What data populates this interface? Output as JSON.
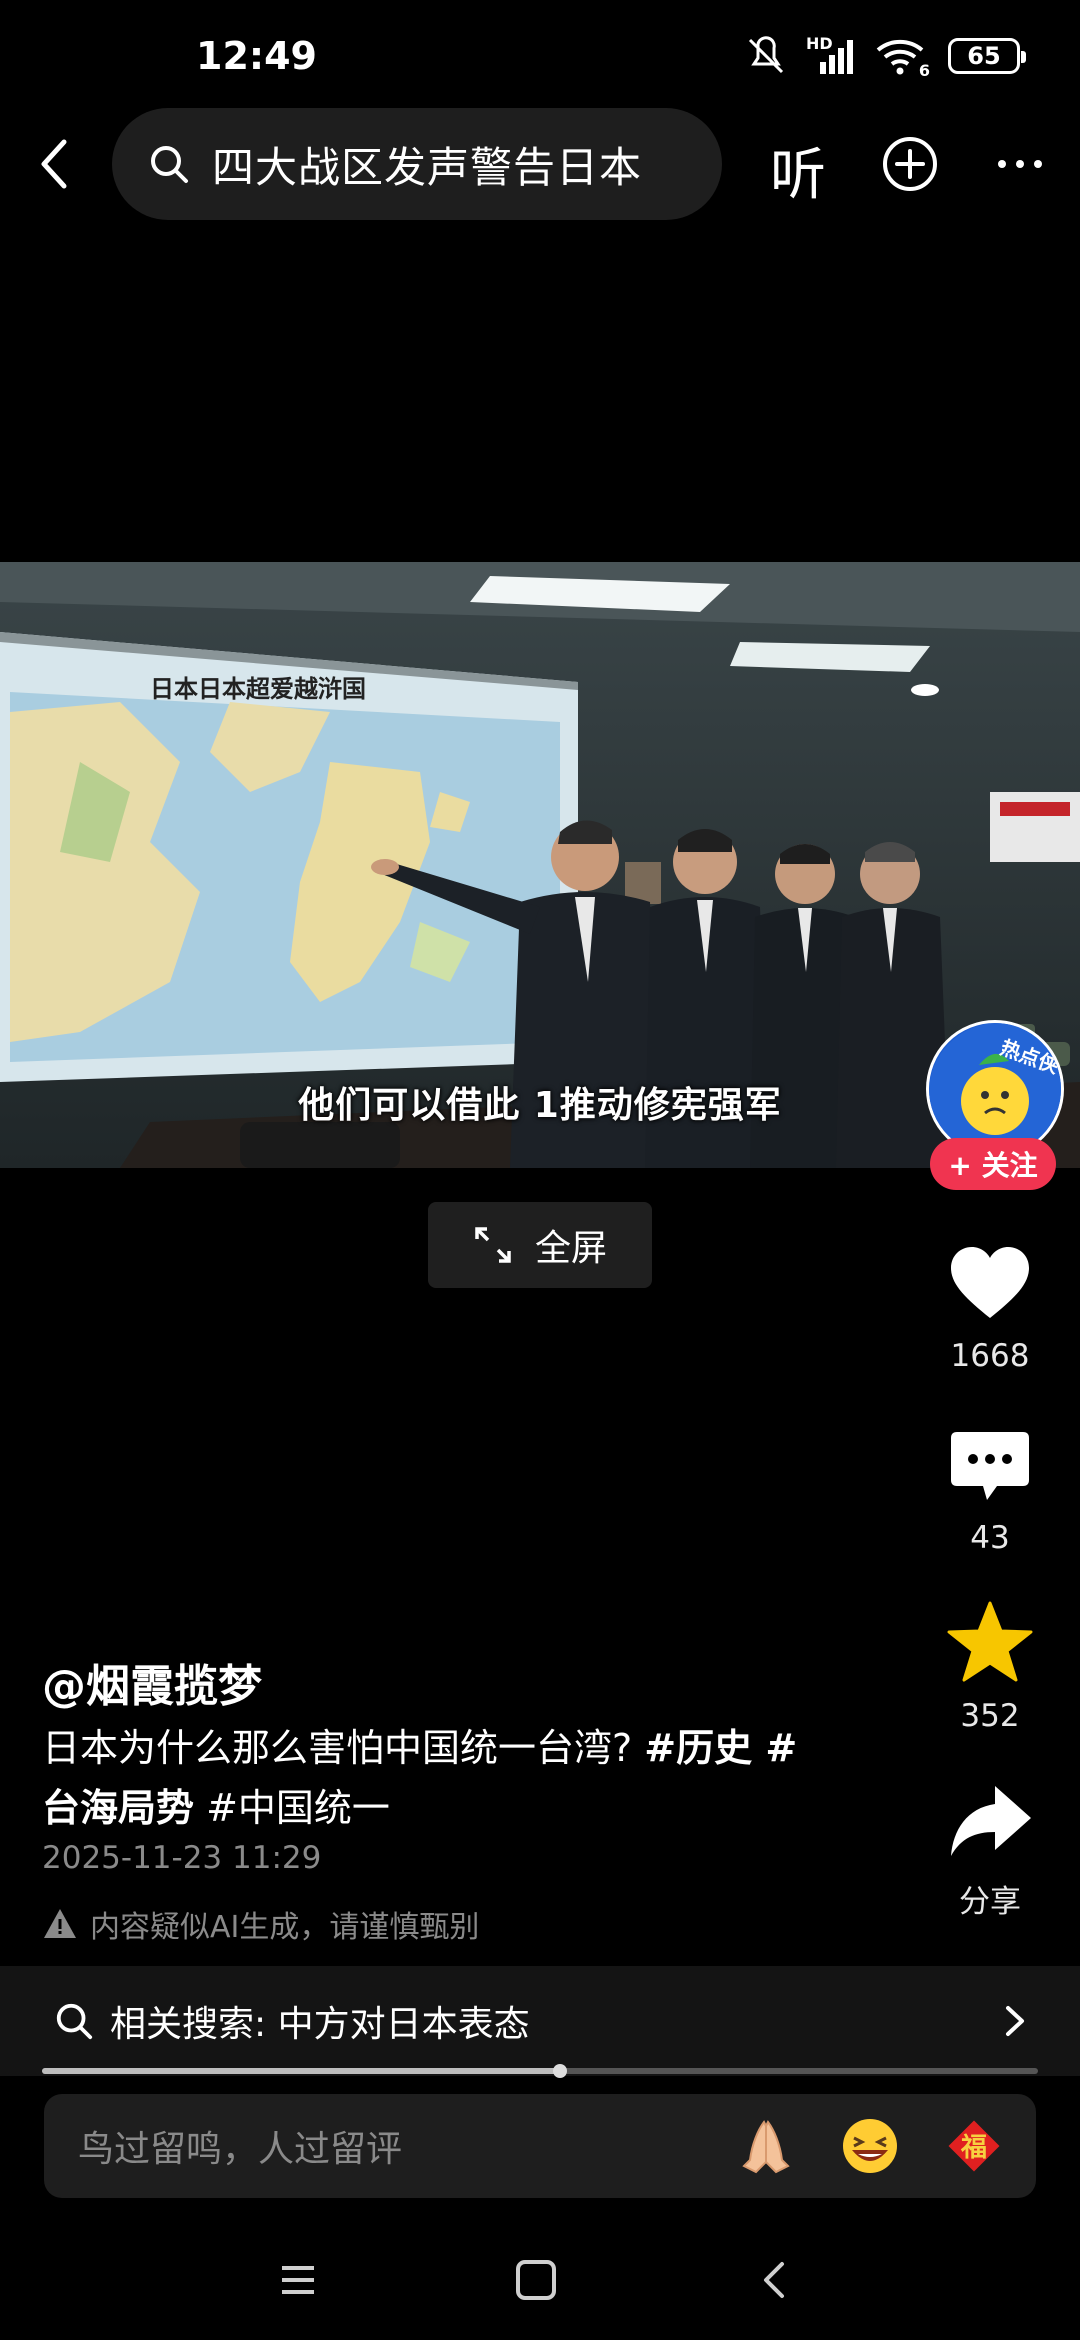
{
  "status_bar": {
    "time": "12:49",
    "network": "HD",
    "wifi_label": "6",
    "battery": "65",
    "icons": [
      "mute-icon",
      "signal-icon",
      "wifi-icon",
      "battery-icon"
    ]
  },
  "top_bar": {
    "search_query": "四大战区发声警告日本",
    "listen_label": "听",
    "icons": [
      "back-icon",
      "search-icon",
      "plus-circle-icon",
      "more-icon"
    ]
  },
  "video": {
    "map_title": "日本日本超爱越浒国",
    "subtitle": "他们可以借此 1推动修宪强军",
    "avatar_badge": "热点侠",
    "follow_label": "+ 关注"
  },
  "fullscreen": {
    "label": "全屏"
  },
  "actions": {
    "likes": "1668",
    "comments": "43",
    "favorites": "352",
    "share_label": "分享",
    "colors": {
      "like": "#ffffff",
      "favorite": "#f7c600"
    }
  },
  "info": {
    "author": "@烟霞揽梦",
    "desc_text": "日本为什么那么害怕中国统一台湾? ",
    "tag1": "#历史 #",
    "tag2": "台海局势",
    "tag3": " #中国统一",
    "date": "2025-11-23 11:29",
    "ai_notice": "内容疑似AI生成，请谨慎甄别"
  },
  "related_search": {
    "label": "相关搜索: 中方对日本表态"
  },
  "playback": {
    "progress": 0.52
  },
  "comment_bar": {
    "placeholder": "鸟过留鸣，人过留评",
    "emojis": [
      "pray-emoji",
      "laugh-emoji",
      "fu-emoji"
    ],
    "fu_char": "福"
  },
  "nav_bar": {
    "icons": [
      "menu-icon",
      "home-icon",
      "back-nav-icon"
    ]
  }
}
